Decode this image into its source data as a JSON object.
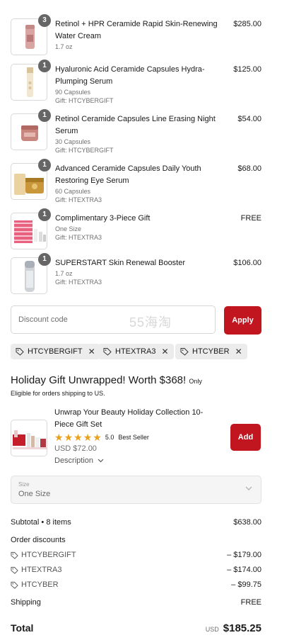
{
  "items": [
    {
      "qty": "3",
      "name": "Retinol + HPR Ceramide Rapid Skin-Renewing Water Cream",
      "meta1": "1.7 oz",
      "meta2": "",
      "price": "$285.00"
    },
    {
      "qty": "1",
      "name": "Hyaluronic Acid Ceramide Capsules Hydra-Plumping Serum",
      "meta1": "90 Capsules",
      "meta2": "Gift: HTCYBERGIFT",
      "price": "$125.00"
    },
    {
      "qty": "1",
      "name": "Retinol Ceramide Capsules Line Erasing Night Serum",
      "meta1": "30 Capsules",
      "meta2": "Gift: HTCYBERGIFT",
      "price": "$54.00"
    },
    {
      "qty": "1",
      "name": "Advanced Ceramide Capsules Daily Youth Restoring Eye Serum",
      "meta1": "60 Capsules",
      "meta2": "Gift: HTEXTRA3",
      "price": "$68.00"
    },
    {
      "qty": "1",
      "name": "Complimentary 3-Piece Gift",
      "meta1": "One Size",
      "meta2": "Gift: HTEXTRA3",
      "price": "FREE"
    },
    {
      "qty": "1",
      "name": "SUPERSTART Skin Renewal Booster",
      "meta1": "1.7 oz",
      "meta2": "Gift: HTEXTRA3",
      "price": "$106.00"
    }
  ],
  "discount": {
    "placeholder": "Discount code",
    "apply_label": "Apply",
    "watermark": "55海淘"
  },
  "applied_codes": [
    "HTCYBERGIFT",
    "HTEXTRA3",
    "HTCYBER"
  ],
  "promo": {
    "title": "Holiday Gift Unwrapped! Worth $368!",
    "title_suffix": "Only",
    "subtitle": "Eligible for orders shipping to US.",
    "product_name": "Unwrap Your Beauty Holiday Collection 10-Piece Gift Set",
    "rating": "5.0",
    "rating_stars": 5,
    "badge": "Best Seller",
    "price": "USD $72.00",
    "description_label": "Description",
    "add_label": "Add",
    "size_label": "Size",
    "size_value": "One Size"
  },
  "summary": {
    "subtotal_label": "Subtotal • 8 items",
    "subtotal_value": "$638.00",
    "order_discounts_label": "Order discounts",
    "discounts": [
      {
        "code": "HTCYBERGIFT",
        "amount": "– $179.00"
      },
      {
        "code": "HTEXTRA3",
        "amount": "– $174.00"
      },
      {
        "code": "HTCYBER",
        "amount": "– $99.75"
      }
    ],
    "shipping_label": "Shipping",
    "shipping_value": "FREE",
    "total_label": "Total",
    "currency": "USD",
    "total_value": "$185.25"
  },
  "colors": {
    "accent": "#c1161f",
    "star": "#e9a11b",
    "badge": "#666666"
  },
  "icons": [
    "tag-icon",
    "close-icon",
    "star-icon",
    "chevron-down-icon"
  ]
}
